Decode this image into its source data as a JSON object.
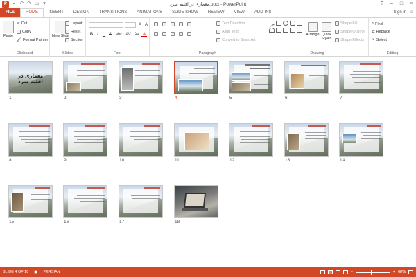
{
  "window": {
    "title": "معماری در اقلیم سرد.pptx - PowerPoint",
    "app_icon": "P",
    "help": "?",
    "controls": [
      "–",
      "□",
      "×"
    ]
  },
  "qat": [
    "save-icon",
    "undo-icon",
    "redo-icon",
    "start-slideshow-icon",
    "customize-icon"
  ],
  "tabs": [
    "FILE",
    "HOME",
    "INSERT",
    "DESIGN",
    "TRANSITIONS",
    "ANIMATIONS",
    "SLIDE SHOW",
    "REVIEW",
    "VIEW",
    "ADD-INS"
  ],
  "active_tab": "HOME",
  "signin": "Sign in",
  "ribbon": {
    "clipboard": {
      "label": "Clipboard",
      "paste": "Paste",
      "cut": "Cut",
      "copy": "Copy",
      "format_painter": "Format Painter"
    },
    "slides": {
      "label": "Slides",
      "new_slide": "New Slide",
      "layout": "Layout",
      "reset": "Reset",
      "section": "Section"
    },
    "font": {
      "label": "Font",
      "size_label": "A",
      "bold": "B",
      "italic": "I",
      "underline": "U",
      "strike": "S",
      "shadow": "abc",
      "spacing": "AV",
      "case": "Aa",
      "color": "A"
    },
    "paragraph": {
      "label": "Paragraph",
      "text_direction": "Text Direction",
      "align_text": "Align Text",
      "convert_smartart": "Convert to SmartArt"
    },
    "drawing": {
      "label": "Drawing",
      "arrange": "Arrange",
      "quick_styles": "Quick Styles",
      "shape_fill": "Shape Fill",
      "shape_outline": "Shape Outline",
      "shape_effects": "Shape Effects"
    },
    "editing": {
      "label": "Editing",
      "find": "Find",
      "replace": "Replace",
      "select": "Select"
    }
  },
  "slides": [
    {
      "num": "1",
      "title": "معماری در اقلیم سرد"
    },
    {
      "num": "2"
    },
    {
      "num": "3"
    },
    {
      "num": "4"
    },
    {
      "num": "5"
    },
    {
      "num": "6"
    },
    {
      "num": "7"
    },
    {
      "num": "8"
    },
    {
      "num": "9"
    },
    {
      "num": "10"
    },
    {
      "num": "11"
    },
    {
      "num": "12"
    },
    {
      "num": "13"
    },
    {
      "num": "14"
    },
    {
      "num": "15"
    },
    {
      "num": "16"
    },
    {
      "num": "17"
    },
    {
      "num": "18"
    }
  ],
  "selected_slide": "4",
  "status": {
    "slide_info": "SLIDE 4 OF 18",
    "language": "PERSIAN",
    "zoom": "68%",
    "zoom_minus": "–",
    "zoom_plus": "+"
  },
  "colors": {
    "accent": "#d24726"
  }
}
